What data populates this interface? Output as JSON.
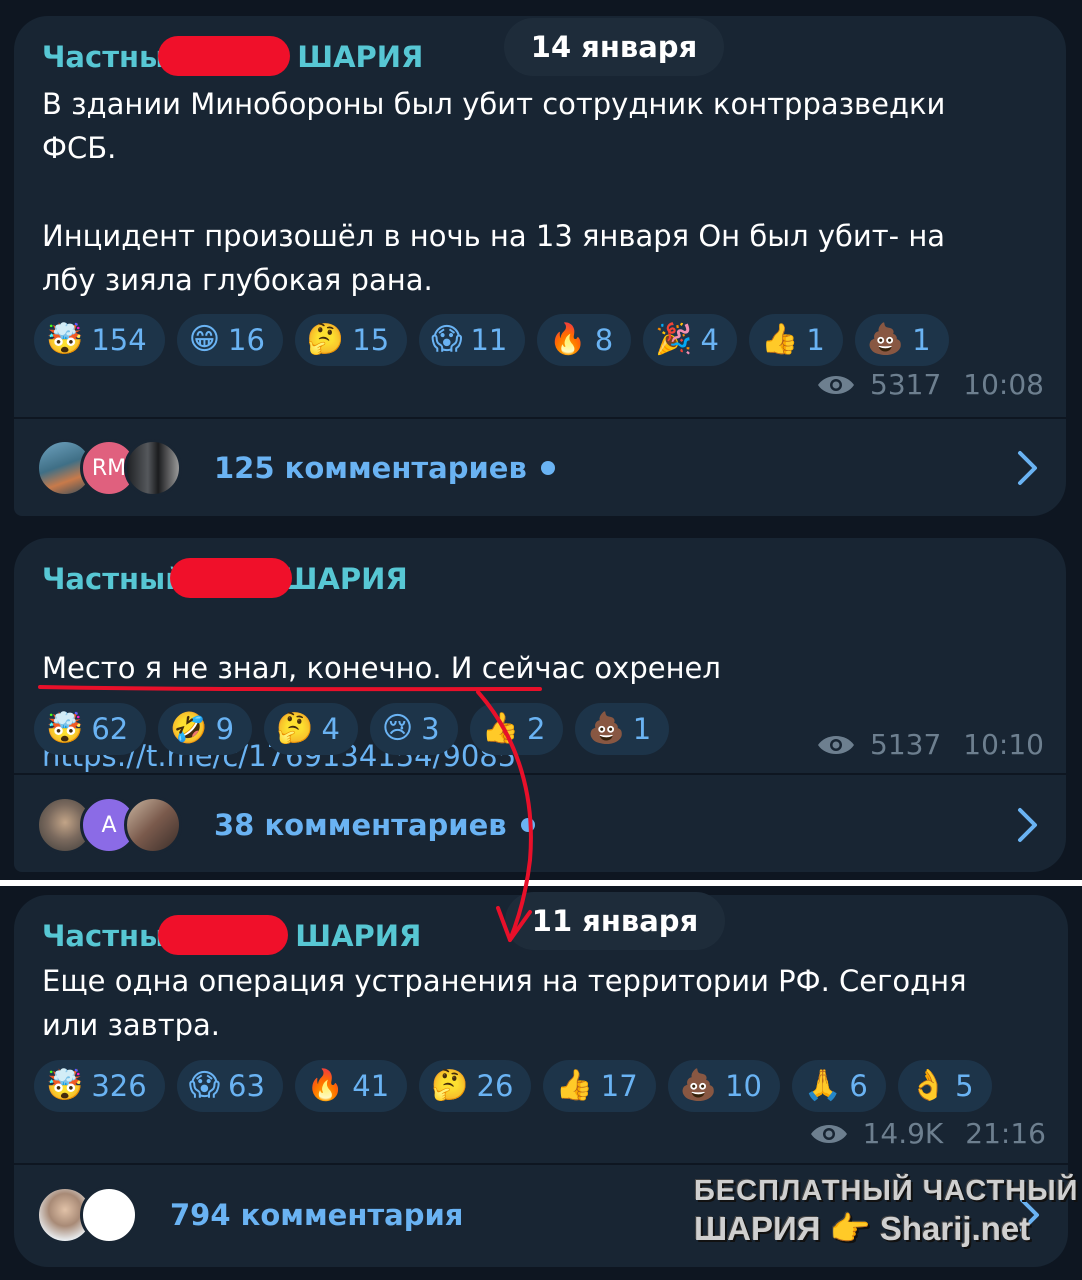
{
  "posts": [
    {
      "sender_prefix": "Частны",
      "sender_suffix": "ШАРИЯ",
      "date_pill": "14 января",
      "text": "В здании Минобороны был убит сотрудник контрразведки ФСБ.\n\nИнцидент произошёл в ночь на 13 января Он был убит-  на лбу зияла глубокая рана.",
      "reactions": [
        {
          "emoji": "🤯",
          "count": "154"
        },
        {
          "emoji": "😁",
          "count": "16"
        },
        {
          "emoji": "🤔",
          "count": "15"
        },
        {
          "emoji": "😱",
          "count": "11"
        },
        {
          "emoji": "🔥",
          "count": "8"
        },
        {
          "emoji": "🎉",
          "count": "4"
        },
        {
          "emoji": "👍",
          "count": "1"
        },
        {
          "emoji": "💩",
          "count": "1"
        }
      ],
      "views": "5317",
      "time": "10:08",
      "comments": "125 комментариев",
      "avatars": [
        {
          "label": "",
          "color": "#3f6f86"
        },
        {
          "label": "RM",
          "color": "#e0607e"
        },
        {
          "label": "",
          "color": "#2a2d30"
        }
      ]
    },
    {
      "sender_prefix": "Частный",
      "sender_suffix": "ШАРИЯ",
      "text_line": "Место я не знал, конечно. И сейчас охренел",
      "link": "https://t.me/c/1769134154/9085",
      "reactions": [
        {
          "emoji": "🤯",
          "count": "62"
        },
        {
          "emoji": "🤣",
          "count": "9"
        },
        {
          "emoji": "🤔",
          "count": "4"
        },
        {
          "emoji": "😢",
          "count": "3"
        },
        {
          "emoji": "👍",
          "count": "2"
        },
        {
          "emoji": "💩",
          "count": "1"
        }
      ],
      "views": "5137",
      "time": "10:10",
      "comments": "38 комментариев",
      "avatars": [
        {
          "label": "",
          "color": "#6d6a66"
        },
        {
          "label": "A",
          "color": "#8b6be6"
        },
        {
          "label": "",
          "color": "#7a5a4c"
        }
      ]
    },
    {
      "sender_prefix": "Частны",
      "sender_suffix": "ШАРИЯ",
      "date_pill": "11 января",
      "text": "Еще одна операция устранения на территории РФ. Сегодня или завтра.",
      "reactions": [
        {
          "emoji": "🤯",
          "count": "326"
        },
        {
          "emoji": "😱",
          "count": "63"
        },
        {
          "emoji": "🔥",
          "count": "41"
        },
        {
          "emoji": "🤔",
          "count": "26"
        },
        {
          "emoji": "👍",
          "count": "17"
        },
        {
          "emoji": "💩",
          "count": "10"
        },
        {
          "emoji": "🙏",
          "count": "6"
        },
        {
          "emoji": "👌",
          "count": "5"
        }
      ],
      "views": "14.9K",
      "time": "21:16",
      "comments": "794 комментария",
      "avatars": [
        {
          "label": "",
          "color": "#c9c3bb"
        },
        {
          "label": "",
          "color": "#ffffff"
        }
      ]
    }
  ],
  "watermark": {
    "line1": "БЕСПЛАТНЫЙ ЧАСТНЫЙ",
    "line2": "ШАРИЯ 👉 Sharij.net"
  },
  "colors": {
    "background": "#0e1621",
    "bubble": "#182533",
    "accent_blue": "#6ab3f3",
    "sender_teal": "#57c7d4",
    "redaction": "#f0102a",
    "annotation_red": "#e8102a"
  }
}
